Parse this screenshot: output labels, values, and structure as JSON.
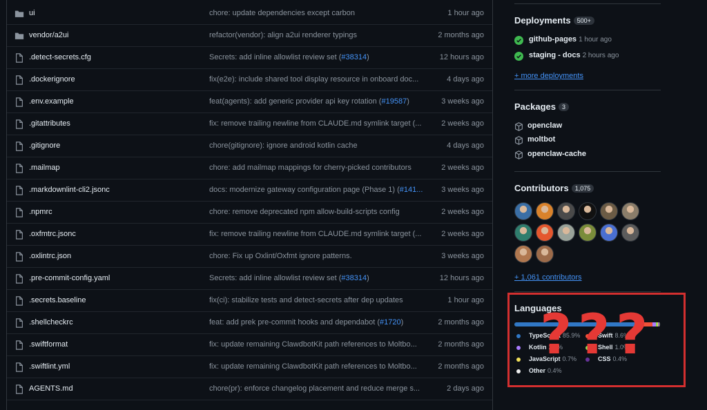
{
  "files": [
    {
      "type": "folder",
      "name": "ui",
      "msg": "chore: update dependencies except carbon",
      "pr": "",
      "msg_after": "",
      "time": "1 hour ago"
    },
    {
      "type": "folder",
      "name": "vendor/a2ui",
      "msg": "refactor(vendor): align a2ui renderer typings",
      "pr": "",
      "msg_after": "",
      "time": "2 months ago"
    },
    {
      "type": "file",
      "name": ".detect-secrets.cfg",
      "msg": "Secrets: add inline allowlist review set (",
      "pr": "#38314",
      "msg_after": ")",
      "time": "12 hours ago"
    },
    {
      "type": "file",
      "name": ".dockerignore",
      "msg": "fix(e2e): include shared tool display resource in onboard doc...",
      "pr": "",
      "msg_after": "",
      "time": "4 days ago"
    },
    {
      "type": "file",
      "name": ".env.example",
      "msg": "feat(agents): add generic provider api key rotation (",
      "pr": "#19587",
      "msg_after": ")",
      "time": "3 weeks ago"
    },
    {
      "type": "file",
      "name": ".gitattributes",
      "msg": "fix: remove trailing newline from CLAUDE.md symlink target (...",
      "pr": "",
      "msg_after": "",
      "time": "2 weeks ago"
    },
    {
      "type": "file",
      "name": ".gitignore",
      "msg": "chore(gitignore): ignore android kotlin cache",
      "pr": "",
      "msg_after": "",
      "time": "4 days ago"
    },
    {
      "type": "file",
      "name": ".mailmap",
      "msg": "chore: add mailmap mappings for cherry-picked contributors",
      "pr": "",
      "msg_after": "",
      "time": "2 weeks ago"
    },
    {
      "type": "file",
      "name": ".markdownlint-cli2.jsonc",
      "msg": "docs: modernize gateway configuration page (Phase 1) (",
      "pr": "#141...",
      "msg_after": "",
      "time": "3 weeks ago"
    },
    {
      "type": "file",
      "name": ".npmrc",
      "msg": "chore: remove deprecated npm allow-build-scripts config",
      "pr": "",
      "msg_after": "",
      "time": "2 weeks ago"
    },
    {
      "type": "file",
      "name": ".oxfmtrc.jsonc",
      "msg": "fix: remove trailing newline from CLAUDE.md symlink target (...",
      "pr": "",
      "msg_after": "",
      "time": "2 weeks ago"
    },
    {
      "type": "file",
      "name": ".oxlintrc.json",
      "msg": "chore: Fix up Oxlint/Oxfmt ignore patterns.",
      "pr": "",
      "msg_after": "",
      "time": "3 weeks ago"
    },
    {
      "type": "file",
      "name": ".pre-commit-config.yaml",
      "msg": "Secrets: add inline allowlist review set (",
      "pr": "#38314",
      "msg_after": ")",
      "time": "12 hours ago"
    },
    {
      "type": "file",
      "name": ".secrets.baseline",
      "msg": "fix(ci): stabilize tests and detect-secrets after dep updates",
      "pr": "",
      "msg_after": "",
      "time": "1 hour ago"
    },
    {
      "type": "file",
      "name": ".shellcheckrc",
      "msg": "feat: add prek pre-commit hooks and dependabot (",
      "pr": "#1720",
      "msg_after": ")",
      "time": "2 months ago"
    },
    {
      "type": "file",
      "name": ".swiftformat",
      "msg": "fix: update remaining ClawdbotKit path references to Moltbo...",
      "pr": "",
      "msg_after": "",
      "time": "2 months ago"
    },
    {
      "type": "file",
      "name": ".swiftlint.yml",
      "msg": "fix: update remaining ClawdbotKit path references to Moltbo...",
      "pr": "",
      "msg_after": "",
      "time": "2 months ago"
    },
    {
      "type": "file",
      "name": "AGENTS.md",
      "msg": "chore(pr): enforce changelog placement and reduce merge s...",
      "pr": "",
      "msg_after": "",
      "time": "2 days ago"
    }
  ],
  "deployments": {
    "title": "Deployments",
    "count": "500+",
    "items": [
      {
        "name": "github-pages",
        "time": "1 hour ago"
      },
      {
        "name": "staging - docs",
        "time": "2 hours ago"
      }
    ],
    "more": "+ more deployments"
  },
  "packages": {
    "title": "Packages",
    "count": "3",
    "items": [
      "openclaw",
      "moltbot",
      "openclaw-cache"
    ]
  },
  "contributors": {
    "title": "Contributors",
    "count": "1,075",
    "avatar_colors": [
      "#3a6ea5",
      "#d9822b",
      "#4a4a4a",
      "#111111",
      "#6b5b45",
      "#8a7d6a",
      "#2f7d6d",
      "#e4572e",
      "#9aa39a",
      "#7a8c3a",
      "#4a6fd1",
      "#5c5c5c",
      "#b07850",
      "#9c6b4a"
    ],
    "more": "+ 1,061 contributors"
  },
  "languages": {
    "title": "Languages",
    "bar": [
      {
        "color": "#3178c6",
        "pct": 85.9
      },
      {
        "color": "#f05138",
        "pct": 8.6
      },
      {
        "color": "#a97bff",
        "pct": 2.0
      },
      {
        "color": "#89e051",
        "pct": 1.0
      },
      {
        "color": "#f1e05a",
        "pct": 0.7
      },
      {
        "color": "#663399",
        "pct": 0.4
      },
      {
        "color": "#ededed",
        "pct": 0.4
      }
    ],
    "items": [
      {
        "name": "TypeScript",
        "pct": "85.9%",
        "color": "#3178c6"
      },
      {
        "name": "Swift",
        "pct": "8.6%",
        "color": "#f05138"
      },
      {
        "name": "Kotlin",
        "pct": "2.0%",
        "color": "#a97bff"
      },
      {
        "name": "Shell",
        "pct": "1.0%",
        "color": "#89e051"
      },
      {
        "name": "JavaScript",
        "pct": "0.7%",
        "color": "#f1e05a"
      },
      {
        "name": "CSS",
        "pct": "0.4%",
        "color": "#663399"
      },
      {
        "name": "Other",
        "pct": "0.4%",
        "color": "#ededed"
      }
    ]
  },
  "annotation": {
    "marks": [
      "?",
      "?",
      "?"
    ],
    "color": "#e53935"
  }
}
